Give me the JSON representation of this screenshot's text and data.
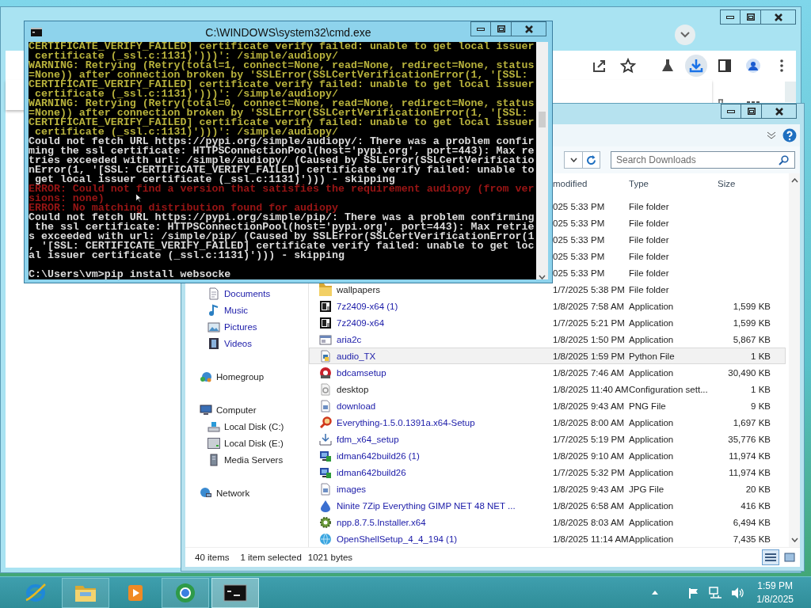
{
  "cmd": {
    "title": "C:\\WINDOWS\\system32\\cmd.exe",
    "lines": [
      {
        "kind": "warning",
        "text": "CERTIFICATE_VERIFY_FAILED] certificate verify failed: unable to get local issuer"
      },
      {
        "kind": "warning",
        "text": " certificate (_ssl.c:1131)')))': /simple/audiopy/"
      },
      {
        "kind": "warning",
        "text": "WARNING: Retrying (Retry(total=1, connect=None, read=None, redirect=None, status"
      },
      {
        "kind": "warning",
        "text": "=None)) after connection broken by 'SSLError(SSLCertVerificationError(1, '[SSL:"
      },
      {
        "kind": "warning",
        "text": "CERTIFICATE_VERIFY_FAILED] certificate verify failed: unable to get local issuer"
      },
      {
        "kind": "warning",
        "text": " certificate (_ssl.c:1131)')))': /simple/audiopy/"
      },
      {
        "kind": "warning",
        "text": "WARNING: Retrying (Retry(total=0, connect=None, read=None, redirect=None, status"
      },
      {
        "kind": "warning",
        "text": "=None)) after connection broken by 'SSLError(SSLCertVerificationError(1, '[SSL:"
      },
      {
        "kind": "warning",
        "text": "CERTIFICATE_VERIFY_FAILED] certificate verify failed: unable to get local issuer"
      },
      {
        "kind": "warning",
        "text": " certificate (_ssl.c:1131)')))': /simple/audiopy/"
      },
      {
        "kind": "output",
        "text": "Could not fetch URL https://pypi.org/simple/audiopy/: There was a problem confir"
      },
      {
        "kind": "output",
        "text": "ming the ssl certificate: HTTPSConnectionPool(host='pypi.org', port=443): Max re"
      },
      {
        "kind": "output",
        "text": "tries exceeded with url: /simple/audiopy/ (Caused by SSLError(SSLCertVerificatio"
      },
      {
        "kind": "output",
        "text": "nError(1, '[SSL: CERTIFICATE_VERIFY_FAILED] certificate verify failed: unable to"
      },
      {
        "kind": "output",
        "text": " get local issuer certificate (_ssl.c:1131)'))) - skipping"
      },
      {
        "kind": "error",
        "text": "ERROR: Could not find a version that satisfies the requirement audiopy (from ver"
      },
      {
        "kind": "error",
        "text": "sions: none)"
      },
      {
        "kind": "error",
        "text": "ERROR: No matching distribution found for audiopy"
      },
      {
        "kind": "output",
        "text": "Could not fetch URL https://pypi.org/simple/pip/: There was a problem confirming"
      },
      {
        "kind": "output",
        "text": " the ssl certificate: HTTPSConnectionPool(host='pypi.org', port=443): Max retrie"
      },
      {
        "kind": "output",
        "text": "s exceeded with url: /simple/pip/ (Caused by SSLError(SSLCertVerificationError(1"
      },
      {
        "kind": "output",
        "text": ", '[SSL: CERTIFICATE_VERIFY_FAILED] certificate verify failed: unable to get loc"
      },
      {
        "kind": "output",
        "text": "al issuer certificate (_ssl.c:1131)'))) - skipping"
      },
      {
        "kind": "blank"
      },
      {
        "kind": "output",
        "text": "C:\\Users\\vm>pip install websocke"
      }
    ]
  },
  "explorer": {
    "search": {
      "placeholder": "Search Downloads"
    },
    "columns": [
      "modified",
      "Type",
      "Size"
    ],
    "nav": {
      "library_items": [
        {
          "kind": "documents",
          "label": "Documents",
          "compressed": true
        },
        {
          "kind": "music",
          "label": "Music",
          "compressed": true
        },
        {
          "kind": "pictures",
          "label": "Pictures",
          "compressed": true
        },
        {
          "kind": "videos",
          "label": "Videos",
          "compressed": true
        }
      ],
      "items": [
        {
          "kind": "homegroup",
          "label": "Homegroup",
          "compressed": false
        },
        {
          "kind": "computer",
          "label": "Computer",
          "compressed": false,
          "children": [
            {
              "kind": "system-drive",
              "label": "Local Disk (C:)",
              "compressed": false
            },
            {
              "kind": "drive",
              "label": "Local Disk (E:)",
              "compressed": false
            },
            {
              "kind": "media-server",
              "label": "Media Servers",
              "compressed": false
            }
          ]
        },
        {
          "kind": "network",
          "label": "Network",
          "compressed": false
        }
      ]
    },
    "files": [
      {
        "kind": "covered",
        "date": "025 5:33 PM",
        "type": "File folder",
        "selected": false
      },
      {
        "kind": "covered",
        "date": "025 5:33 PM",
        "type": "File folder",
        "selected": false
      },
      {
        "kind": "covered",
        "date": "025 5:33 PM",
        "type": "File folder",
        "selected": false
      },
      {
        "kind": "covered",
        "date": "025 5:33 PM",
        "type": "File folder",
        "selected": false
      },
      {
        "kind": "covered",
        "date": "025 5:33 PM",
        "type": "File folder",
        "selected": false
      },
      {
        "kind": "folder",
        "name": "wallpapers",
        "date": "1/7/2025 5:38 PM",
        "type": "File folder",
        "compressed": false,
        "selected": false
      },
      {
        "kind": "archiver",
        "name": "7z2409-x64 (1)",
        "date": "1/8/2025 7:58 AM",
        "type": "Application",
        "size": "1,599 KB",
        "compressed": true,
        "selected": false
      },
      {
        "kind": "archiver",
        "name": "7z2409-x64",
        "date": "1/7/2025 5:21 PM",
        "type": "Application",
        "size": "1,599 KB",
        "compressed": true,
        "selected": false
      },
      {
        "kind": "window-app",
        "name": "aria2c",
        "date": "1/8/2025 1:50 PM",
        "type": "Application",
        "size": "5,867 KB",
        "compressed": true,
        "selected": false
      },
      {
        "kind": "script",
        "name": "audio_TX",
        "date": "1/8/2025 1:59 PM",
        "type": "Python File",
        "size": "1 KB",
        "compressed": true,
        "selected": true
      },
      {
        "kind": "record-app",
        "name": "bdcamsetup",
        "date": "1/8/2025 7:46 AM",
        "type": "Application",
        "size": "30,490 KB",
        "compressed": true,
        "selected": false
      },
      {
        "kind": "settings",
        "name": "desktop",
        "date": "1/8/2025 11:40 AM",
        "type": "Configuration sett...",
        "size": "1 KB",
        "compressed": false,
        "selected": false
      },
      {
        "kind": "image",
        "name": "download",
        "date": "1/8/2025 9:43 AM",
        "type": "PNG File",
        "size": "9 KB",
        "compressed": true,
        "selected": false
      },
      {
        "kind": "magnifier-app",
        "name": "Everything-1.5.0.1391a.x64-Setup",
        "date": "1/8/2025 8:00 AM",
        "type": "Application",
        "size": "1,697 KB",
        "compressed": true,
        "selected": false
      },
      {
        "kind": "download-app",
        "name": "fdm_x64_setup",
        "date": "1/7/2025 5:19 PM",
        "type": "Application",
        "size": "35,776 KB",
        "compressed": true,
        "selected": false
      },
      {
        "kind": "monitor-app",
        "name": "idman642build26 (1)",
        "date": "1/8/2025 9:10 AM",
        "type": "Application",
        "size": "11,974 KB",
        "compressed": true,
        "selected": false
      },
      {
        "kind": "monitor-app",
        "name": "idman642build26",
        "date": "1/7/2025 5:32 PM",
        "type": "Application",
        "size": "11,974 KB",
        "compressed": true,
        "selected": false
      },
      {
        "kind": "image",
        "name": "images",
        "date": "1/8/2025 9:43 AM",
        "type": "JPG File",
        "size": "20 KB",
        "compressed": true,
        "selected": false
      },
      {
        "kind": "drop-app",
        "name": "Ninite 7Zip Everything GIMP NET 48 NET ...",
        "date": "1/8/2025 6:58 AM",
        "type": "Application",
        "size": "416 KB",
        "compressed": true,
        "selected": false
      },
      {
        "kind": "gear-app",
        "name": "npp.8.7.5.Installer.x64",
        "date": "1/8/2025 8:03 AM",
        "type": "Application",
        "size": "6,494 KB",
        "compressed": true,
        "selected": false
      },
      {
        "kind": "globe-app",
        "name": "OpenShellSetup_4_4_194 (1)",
        "date": "1/8/2025 11:14 AM",
        "type": "Application",
        "size": "7,435 KB",
        "compressed": true,
        "selected": false
      }
    ],
    "status": {
      "count": "40 items",
      "selection": "1 item selected",
      "size": "1021 bytes"
    },
    "views": [
      {
        "kind": "details",
        "selected": true
      },
      {
        "kind": "large-icons",
        "selected": false
      }
    ]
  },
  "taskbar": {
    "apps": [
      {
        "kind": "browser",
        "running": false,
        "selected": false
      },
      {
        "kind": "files",
        "running": true,
        "selected": false
      },
      {
        "kind": "media",
        "running": false,
        "selected": false
      },
      {
        "kind": "web",
        "running": true,
        "selected": false
      },
      {
        "kind": "terminal",
        "running": true,
        "selected": true
      }
    ],
    "clock": {
      "time": "1:59 PM",
      "date": "1/8/2025"
    }
  }
}
